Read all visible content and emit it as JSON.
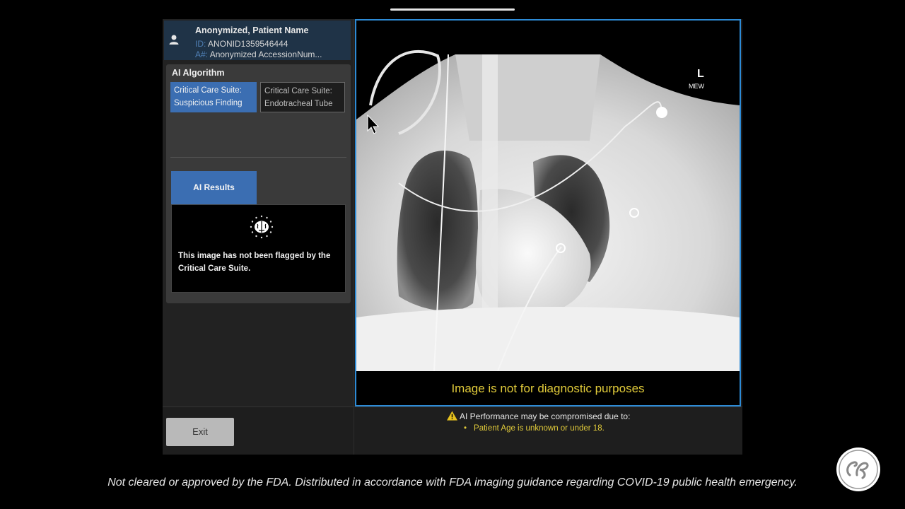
{
  "patient": {
    "name": "Anonymized, Patient Name",
    "id_key": "ID:",
    "id_value": "ANONID1359546444",
    "acc_key": "A#:",
    "acc_value": "Anonymized AccessionNum..."
  },
  "algorithm": {
    "title": "AI Algorithm",
    "tabs": [
      {
        "line1": "Critical Care Suite:",
        "line2": "Suspicious Finding",
        "selected": true
      },
      {
        "line1": "Critical Care Suite:",
        "line2": "Endotracheal Tube",
        "selected": false
      }
    ]
  },
  "results": {
    "tab_label": "AI Results",
    "message": "This image has not been flagged by the Critical Care Suite.",
    "icon": "brain-icon"
  },
  "viewer": {
    "marker": "L",
    "marker_sub": "MEW",
    "footer": "Image is not for diagnostic purposes"
  },
  "warning": {
    "heading": "AI Performance may be compromised due to:",
    "items": [
      "Patient Age is unknown or under 18."
    ]
  },
  "exit_label": "Exit",
  "disclaimer": "Not cleared or approved by the FDA. Distributed in accordance with FDA imaging guidance regarding COVID-19 public health emergency.",
  "colors": {
    "accent": "#3b6eb2",
    "viewer_border": "#2d8bd6",
    "warning_text": "#e1cb3a"
  }
}
